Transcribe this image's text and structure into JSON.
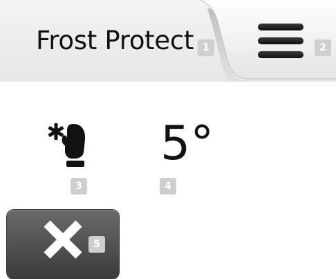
{
  "header": {
    "title": "Frost Protect"
  },
  "badges": {
    "b1": "1",
    "b2": "2",
    "b3": "3",
    "b4": "4",
    "b5": "5"
  },
  "setpoint": {
    "icon": "frost-mitten-icon",
    "value": "5°"
  },
  "footer": {
    "cancel_icon": "close-icon"
  }
}
